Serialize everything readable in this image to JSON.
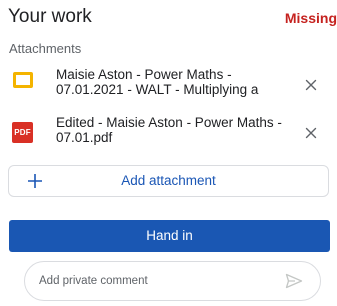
{
  "header": {
    "title": "Your work",
    "status": "Missing"
  },
  "attachments_label": "Attachments",
  "attachments": [
    {
      "title": "Maisie Aston - Power Maths - 07.01.2021 - WALT - Multiplying a",
      "icon": "slides-icon",
      "icon_color": "#f4b400"
    },
    {
      "title": "Edited - Maisie Aston - Power Maths - 07.01.pdf",
      "icon": "pdf-icon",
      "icon_text": "PDF",
      "icon_color": "#d93025"
    }
  ],
  "add_attachment": {
    "label": "Add attachment"
  },
  "hand_in": {
    "label": "Hand in",
    "color": "#1a57b3"
  },
  "comment": {
    "placeholder": "Add private comment"
  },
  "colors": {
    "status": "#c5221f",
    "accent": "#1a56b5"
  }
}
